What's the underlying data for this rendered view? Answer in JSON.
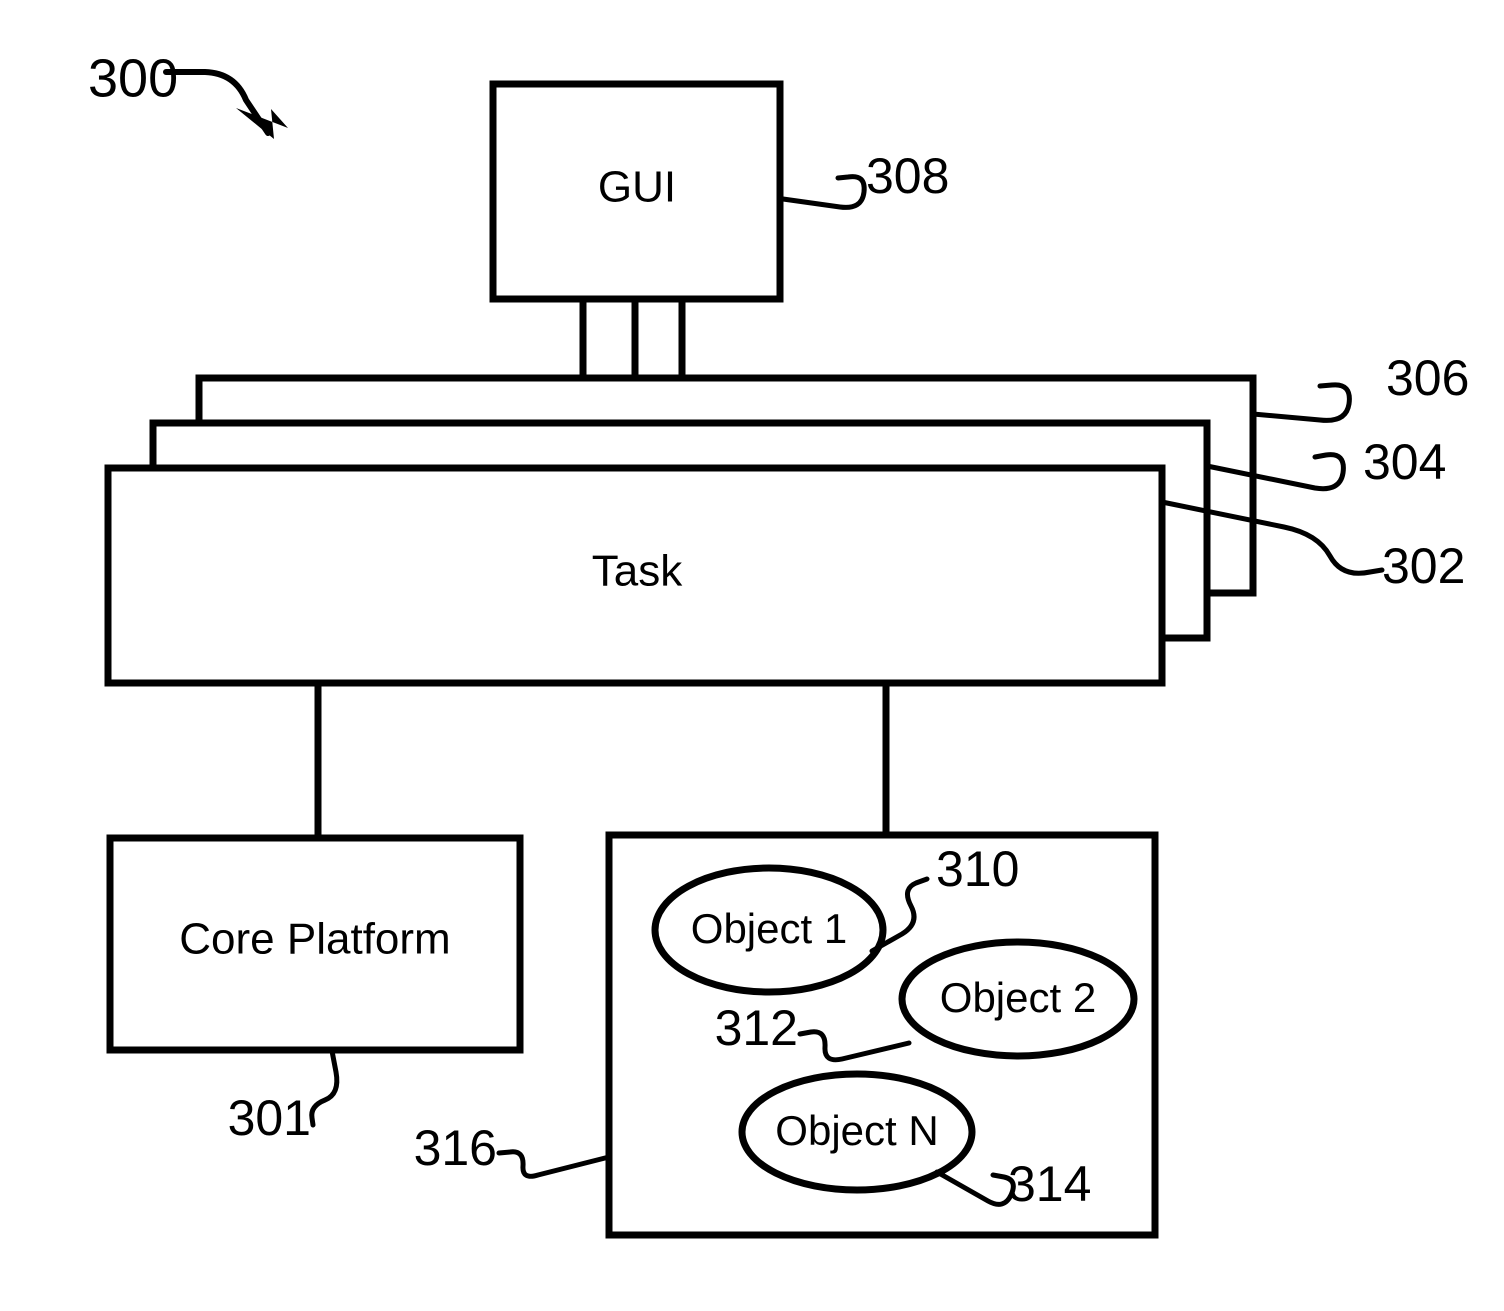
{
  "figure": {
    "figure_number": "300",
    "blocks": {
      "gui": {
        "label": "GUI",
        "ref": "308"
      },
      "layer_back": {
        "ref": "306"
      },
      "layer_middle": {
        "ref": "304"
      },
      "task": {
        "label": "Task",
        "ref": "302"
      },
      "core_platform": {
        "label": "Core Platform",
        "ref": "301"
      },
      "object_container": {
        "ref": "316"
      }
    },
    "objects": [
      {
        "label": "Object 1",
        "ref": "310"
      },
      {
        "label": "Object 2",
        "ref": "312"
      },
      {
        "label": "Object N",
        "ref": "314"
      }
    ],
    "colors": {
      "stroke": "#000000",
      "fill": "#ffffff",
      "background": "#ffffff"
    }
  }
}
